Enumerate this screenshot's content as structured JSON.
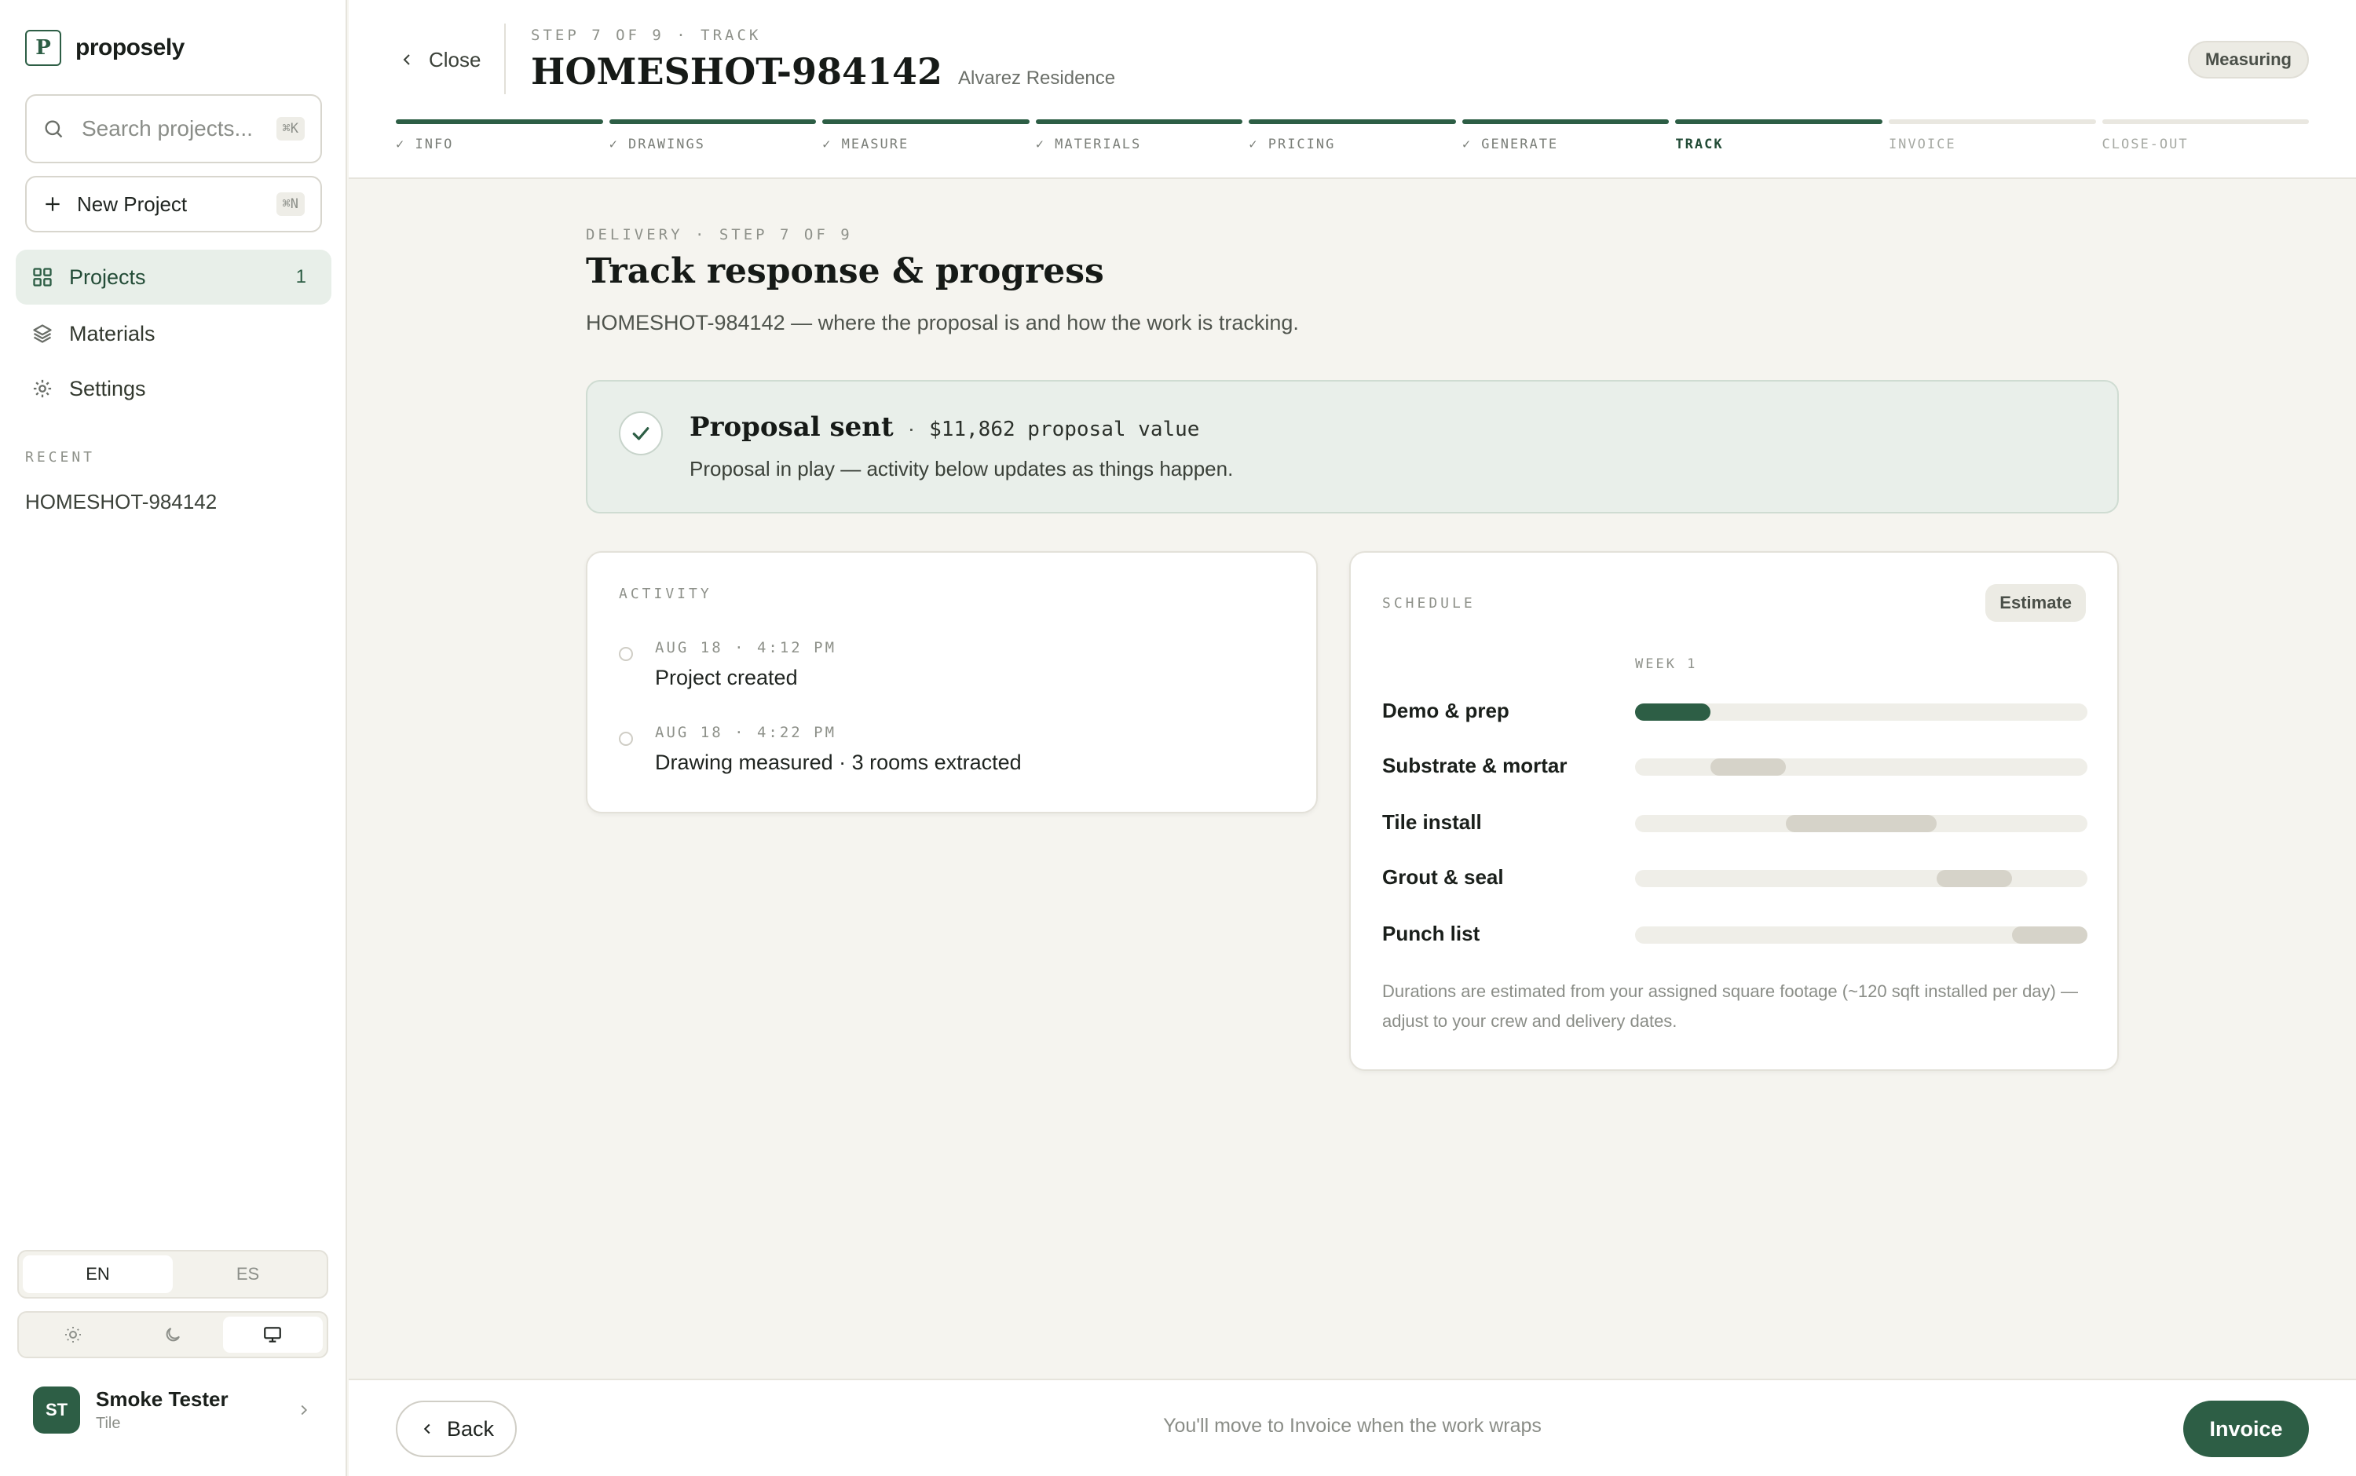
{
  "brand": {
    "name": "proposely",
    "logo_letter": "P"
  },
  "sidebar": {
    "search": {
      "placeholder": "Search projects...",
      "shortcut": "⌘K"
    },
    "new_project": {
      "label": "New Project",
      "shortcut": "⌘N"
    },
    "nav": [
      {
        "label": "Projects",
        "count": "1",
        "icon": "grid-icon",
        "active": true
      },
      {
        "label": "Materials",
        "icon": "layers-icon"
      },
      {
        "label": "Settings",
        "icon": "gear-icon"
      }
    ],
    "recent_heading": "RECENT",
    "recent_items": [
      "HOMESHOT-984142"
    ],
    "language": {
      "options": [
        "EN",
        "ES"
      ],
      "selected": "EN"
    },
    "theme": {
      "options": [
        "sun-icon",
        "moon-icon",
        "monitor-icon"
      ],
      "selected": "monitor-icon"
    },
    "user": {
      "initials": "ST",
      "name": "Smoke Tester",
      "role": "Tile"
    }
  },
  "header": {
    "close_label": "Close",
    "step_eyebrow": "STEP 7 OF 9 · TRACK",
    "project_id": "HOMESHOT-984142",
    "client": "Alvarez Residence",
    "status": "Measuring",
    "steps": [
      {
        "label": "✓ INFO",
        "state": "done"
      },
      {
        "label": "✓ DRAWINGS",
        "state": "done"
      },
      {
        "label": "✓ MEASURE",
        "state": "done"
      },
      {
        "label": "✓ MATERIALS",
        "state": "done"
      },
      {
        "label": "✓ PRICING",
        "state": "done"
      },
      {
        "label": "✓ GENERATE",
        "state": "done"
      },
      {
        "label": "TRACK",
        "state": "current"
      },
      {
        "label": "INVOICE",
        "state": "todo"
      },
      {
        "label": "CLOSE-OUT",
        "state": "todo"
      }
    ]
  },
  "main": {
    "eyebrow": "DELIVERY · STEP 7 OF 9",
    "title": "Track response & progress",
    "subtitle": "HOMESHOT-984142 — where the proposal is and how the work is tracking.",
    "banner": {
      "title": "Proposal sent",
      "separator": "·",
      "value": "$11,862 proposal value",
      "description": "Proposal in play — activity below updates as things happen."
    },
    "activity": {
      "heading": "ACTIVITY",
      "items": [
        {
          "time": "AUG 18 · 4:12 PM",
          "text": "Project created"
        },
        {
          "time": "AUG 18 · 4:22 PM",
          "text": "Drawing measured · 3 rooms extracted"
        }
      ]
    },
    "schedule": {
      "heading": "SCHEDULE",
      "badge": "Estimate",
      "week_label": "WEEK 1",
      "tasks": [
        {
          "name": "Demo & prep",
          "start": 0.0,
          "end": 0.1667,
          "active": true
        },
        {
          "name": "Substrate & mortar",
          "start": 0.1667,
          "end": 0.3333,
          "active": false
        },
        {
          "name": "Tile install",
          "start": 0.3333,
          "end": 0.6667,
          "active": false
        },
        {
          "name": "Grout & seal",
          "start": 0.6667,
          "end": 0.8333,
          "active": false
        },
        {
          "name": "Punch list",
          "start": 0.8333,
          "end": 1.0,
          "active": false
        }
      ],
      "note": "Durations are estimated from your assigned square footage (~120 sqft installed per day) — adjust to your crew and delivery dates."
    }
  },
  "footer": {
    "back_label": "Back",
    "hint": "You'll move to Invoice when the work wraps",
    "next_label": "Invoice"
  },
  "colors": {
    "accent": "#2d5e45",
    "background": "#f5f4ef",
    "banner_bg": "#e9efea"
  }
}
